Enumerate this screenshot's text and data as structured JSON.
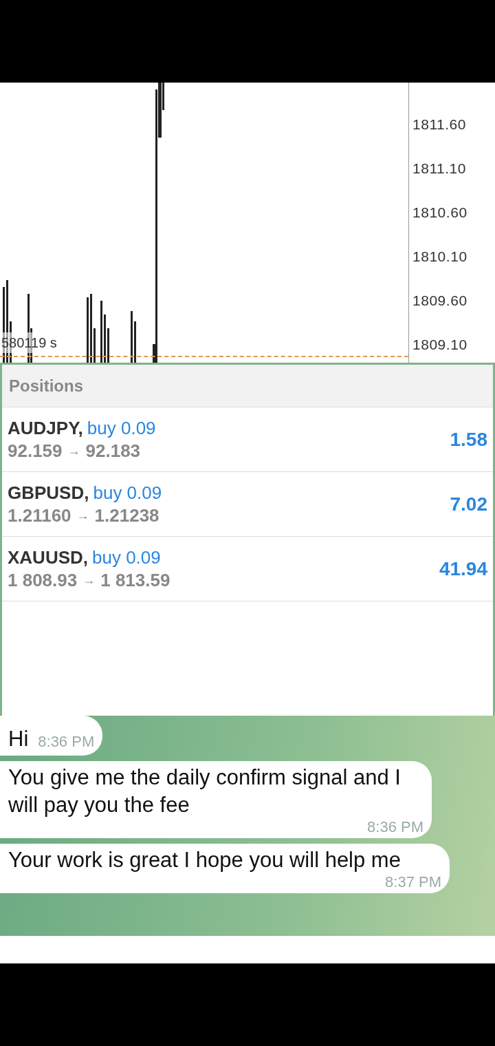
{
  "chart": {
    "price_labels": [
      "1811.60",
      "1811.10",
      "1810.60",
      "1810.10",
      "1809.60",
      "1809.10"
    ],
    "overlay_label": "580119 s"
  },
  "positions": {
    "title": "Positions",
    "items": [
      {
        "symbol": "AUDJPY,",
        "order": "buy 0.09",
        "open": "92.159",
        "arrow": "→",
        "current": "92.183",
        "profit": "1.58"
      },
      {
        "symbol": "GBPUSD,",
        "order": "buy 0.09",
        "open": "1.21160",
        "arrow": "→",
        "current": "1.21238",
        "profit": "7.02"
      },
      {
        "symbol": "XAUUSD,",
        "order": "buy 0.09",
        "open": "1 808.93",
        "arrow": "→",
        "current": "1 813.59",
        "profit": "41.94"
      }
    ]
  },
  "chat": {
    "messages": [
      {
        "text": "Hi",
        "time": "8:36 PM"
      },
      {
        "text": "You give me the daily confirm signal and I will pay you the fee",
        "time": "8:36 PM"
      },
      {
        "text": "Your work is great I hope you will help me",
        "time": "8:37 PM"
      }
    ]
  }
}
